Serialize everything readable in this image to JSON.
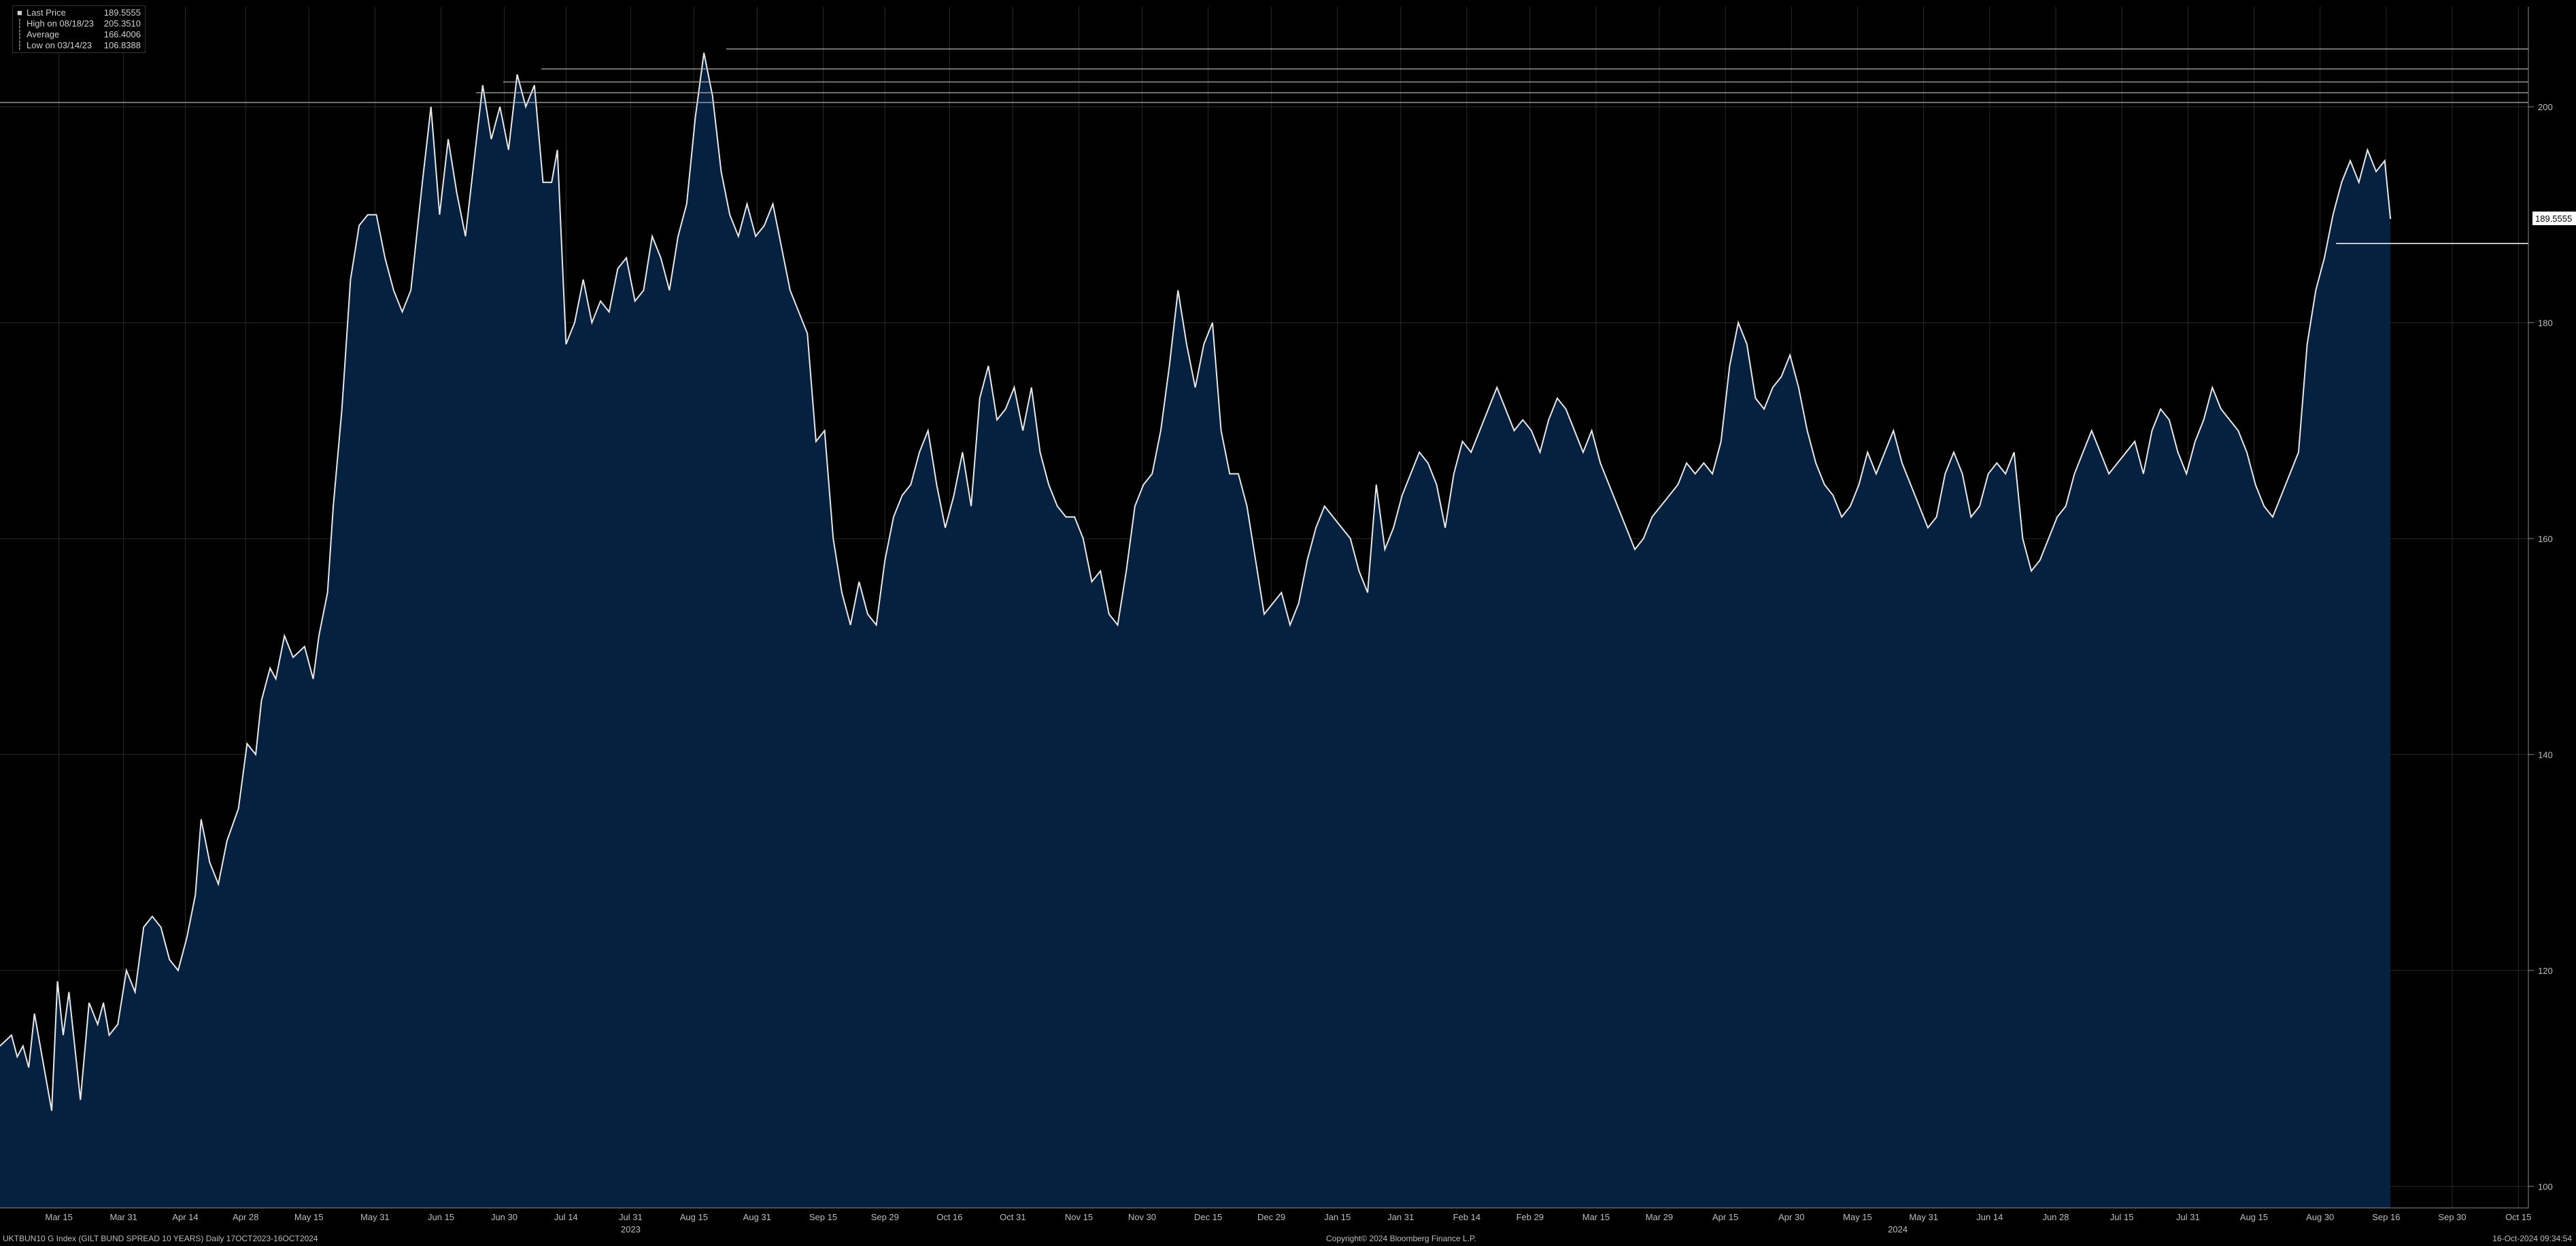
{
  "legend": [
    {
      "label": "Last Price",
      "value": "189.5555",
      "color": "#ffffff",
      "marker": "box"
    },
    {
      "label": "High on 08/18/23",
      "value": "205.3510",
      "color": "#ffffff",
      "marker": "line"
    },
    {
      "label": "Average",
      "value": "166.4006",
      "color": "#ffffff",
      "marker": "line"
    },
    {
      "label": "Low on 03/14/23",
      "value": "106.8388",
      "color": "#ffffff",
      "marker": "line"
    }
  ],
  "footer": {
    "left": "UKTBUN10 G Index (GILT BUND SPREAD 10 YEARS)  Daily 17OCT2023-16OCT2024",
    "center": "Copyright© 2024 Bloomberg Finance L.P.",
    "right": "16-Oct-2024 09:34:54"
  },
  "colors": {
    "background": "#000000",
    "fill": "#06203f",
    "line": "#e8e8e8",
    "grid": "#2a2a2a"
  },
  "chart_data": {
    "type": "area",
    "ylim": [
      98,
      208
    ],
    "yticks": [
      100,
      120,
      140,
      160,
      180,
      200
    ],
    "last_price_label": "189.5555",
    "x_tick_labels": [
      "Mar 15",
      "Mar 31",
      "Apr 14",
      "Apr 28",
      "May 15",
      "May 31",
      "Jun 15",
      "Jun 30",
      "Jul 14",
      "Jul 31",
      "Aug 15",
      "Aug 31",
      "Sep 15",
      "Sep 29",
      "Oct 16",
      "Oct 31",
      "Nov 15",
      "Nov 30",
      "Dec 15",
      "Dec 29",
      "Jan 15",
      "Jan 31",
      "Feb 14",
      "Feb 29",
      "Mar 15",
      "Mar 29",
      "Apr 15",
      "Apr 30",
      "May 15",
      "May 31",
      "Jun 14",
      "Jun 28",
      "Jul 15",
      "Jul 31",
      "Aug 15",
      "Aug 30",
      "Sep 16",
      "Sep 30",
      "Oct 15"
    ],
    "x_tick_index": [
      41,
      86,
      129,
      171,
      215,
      261,
      307,
      351,
      394,
      439,
      483,
      527,
      573,
      616,
      661,
      705,
      751,
      795,
      841,
      885,
      931,
      975,
      1021,
      1065,
      1111,
      1155,
      1201,
      1247,
      1293,
      1339,
      1385,
      1431,
      1477,
      1523,
      1569,
      1615,
      1661,
      1707,
      1753
    ],
    "year_labels": [
      {
        "label": "2023",
        "at": 439
      },
      {
        "label": "2024",
        "at": 1321
      }
    ],
    "x_range": [
      0,
      1760
    ],
    "series": [
      {
        "points": [
          [
            0,
            113
          ],
          [
            8,
            114
          ],
          [
            12,
            112
          ],
          [
            16,
            113
          ],
          [
            20,
            111
          ],
          [
            24,
            116
          ],
          [
            28,
            113
          ],
          [
            32,
            110
          ],
          [
            36,
            107
          ],
          [
            40,
            119
          ],
          [
            44,
            114
          ],
          [
            48,
            118
          ],
          [
            52,
            113
          ],
          [
            56,
            108
          ],
          [
            62,
            117
          ],
          [
            68,
            115
          ],
          [
            72,
            117
          ],
          [
            76,
            114
          ],
          [
            82,
            115
          ],
          [
            88,
            120
          ],
          [
            94,
            118
          ],
          [
            100,
            124
          ],
          [
            106,
            125
          ],
          [
            112,
            124
          ],
          [
            118,
            121
          ],
          [
            124,
            120
          ],
          [
            130,
            123
          ],
          [
            136,
            127
          ],
          [
            140,
            134
          ],
          [
            146,
            130
          ],
          [
            152,
            128
          ],
          [
            158,
            132
          ],
          [
            166,
            135
          ],
          [
            172,
            141
          ],
          [
            178,
            140
          ],
          [
            182,
            145
          ],
          [
            188,
            148
          ],
          [
            192,
            147
          ],
          [
            198,
            151
          ],
          [
            204,
            149
          ],
          [
            212,
            150
          ],
          [
            218,
            147
          ],
          [
            222,
            151
          ],
          [
            228,
            155
          ],
          [
            232,
            163
          ],
          [
            238,
            172
          ],
          [
            244,
            184
          ],
          [
            250,
            189
          ],
          [
            256,
            190
          ],
          [
            262,
            190
          ],
          [
            268,
            186
          ],
          [
            274,
            183
          ],
          [
            280,
            181
          ],
          [
            286,
            183
          ],
          [
            294,
            193
          ],
          [
            300,
            200
          ],
          [
            306,
            190
          ],
          [
            312,
            197
          ],
          [
            318,
            192
          ],
          [
            324,
            188
          ],
          [
            330,
            195
          ],
          [
            336,
            202
          ],
          [
            342,
            197
          ],
          [
            348,
            200
          ],
          [
            354,
            196
          ],
          [
            360,
            203
          ],
          [
            366,
            200
          ],
          [
            372,
            202
          ],
          [
            378,
            193
          ],
          [
            384,
            193
          ],
          [
            388,
            196
          ],
          [
            394,
            178
          ],
          [
            400,
            180
          ],
          [
            406,
            184
          ],
          [
            412,
            180
          ],
          [
            418,
            182
          ],
          [
            424,
            181
          ],
          [
            430,
            185
          ],
          [
            436,
            186
          ],
          [
            442,
            182
          ],
          [
            448,
            183
          ],
          [
            454,
            188
          ],
          [
            460,
            186
          ],
          [
            466,
            183
          ],
          [
            472,
            188
          ],
          [
            478,
            191
          ],
          [
            484,
            199
          ],
          [
            490,
            205
          ],
          [
            496,
            201
          ],
          [
            502,
            194
          ],
          [
            508,
            190
          ],
          [
            514,
            188
          ],
          [
            520,
            191
          ],
          [
            526,
            188
          ],
          [
            532,
            189
          ],
          [
            538,
            191
          ],
          [
            544,
            187
          ],
          [
            550,
            183
          ],
          [
            556,
            181
          ],
          [
            562,
            179
          ],
          [
            568,
            169
          ],
          [
            574,
            170
          ],
          [
            580,
            160
          ],
          [
            586,
            155
          ],
          [
            592,
            152
          ],
          [
            598,
            156
          ],
          [
            604,
            153
          ],
          [
            610,
            152
          ],
          [
            616,
            158
          ],
          [
            622,
            162
          ],
          [
            628,
            164
          ],
          [
            634,
            165
          ],
          [
            640,
            168
          ],
          [
            646,
            170
          ],
          [
            652,
            165
          ],
          [
            658,
            161
          ],
          [
            664,
            164
          ],
          [
            670,
            168
          ],
          [
            676,
            163
          ],
          [
            682,
            173
          ],
          [
            688,
            176
          ],
          [
            694,
            171
          ],
          [
            700,
            172
          ],
          [
            706,
            174
          ],
          [
            712,
            170
          ],
          [
            718,
            174
          ],
          [
            724,
            168
          ],
          [
            730,
            165
          ],
          [
            736,
            163
          ],
          [
            742,
            162
          ],
          [
            748,
            162
          ],
          [
            754,
            160
          ],
          [
            760,
            156
          ],
          [
            766,
            157
          ],
          [
            772,
            153
          ],
          [
            778,
            152
          ],
          [
            784,
            157
          ],
          [
            790,
            163
          ],
          [
            796,
            165
          ],
          [
            802,
            166
          ],
          [
            808,
            170
          ],
          [
            814,
            176
          ],
          [
            820,
            183
          ],
          [
            826,
            178
          ],
          [
            832,
            174
          ],
          [
            838,
            178
          ],
          [
            844,
            180
          ],
          [
            850,
            170
          ],
          [
            856,
            166
          ],
          [
            862,
            166
          ],
          [
            868,
            163
          ],
          [
            874,
            158
          ],
          [
            880,
            153
          ],
          [
            886,
            154
          ],
          [
            892,
            155
          ],
          [
            898,
            152
          ],
          [
            904,
            154
          ],
          [
            910,
            158
          ],
          [
            916,
            161
          ],
          [
            922,
            163
          ],
          [
            928,
            162
          ],
          [
            934,
            161
          ],
          [
            940,
            160
          ],
          [
            946,
            157
          ],
          [
            952,
            155
          ],
          [
            958,
            165
          ],
          [
            964,
            159
          ],
          [
            970,
            161
          ],
          [
            976,
            164
          ],
          [
            982,
            166
          ],
          [
            988,
            168
          ],
          [
            994,
            167
          ],
          [
            1000,
            165
          ],
          [
            1006,
            161
          ],
          [
            1012,
            166
          ],
          [
            1018,
            169
          ],
          [
            1024,
            168
          ],
          [
            1030,
            170
          ],
          [
            1036,
            172
          ],
          [
            1042,
            174
          ],
          [
            1048,
            172
          ],
          [
            1054,
            170
          ],
          [
            1060,
            171
          ],
          [
            1066,
            170
          ],
          [
            1072,
            168
          ],
          [
            1078,
            171
          ],
          [
            1084,
            173
          ],
          [
            1090,
            172
          ],
          [
            1096,
            170
          ],
          [
            1102,
            168
          ],
          [
            1108,
            170
          ],
          [
            1114,
            167
          ],
          [
            1120,
            165
          ],
          [
            1126,
            163
          ],
          [
            1132,
            161
          ],
          [
            1138,
            159
          ],
          [
            1144,
            160
          ],
          [
            1150,
            162
          ],
          [
            1156,
            163
          ],
          [
            1162,
            164
          ],
          [
            1168,
            165
          ],
          [
            1174,
            167
          ],
          [
            1180,
            166
          ],
          [
            1186,
            167
          ],
          [
            1192,
            166
          ],
          [
            1198,
            169
          ],
          [
            1204,
            176
          ],
          [
            1210,
            180
          ],
          [
            1216,
            178
          ],
          [
            1222,
            173
          ],
          [
            1228,
            172
          ],
          [
            1234,
            174
          ],
          [
            1240,
            175
          ],
          [
            1246,
            177
          ],
          [
            1252,
            174
          ],
          [
            1258,
            170
          ],
          [
            1264,
            167
          ],
          [
            1270,
            165
          ],
          [
            1276,
            164
          ],
          [
            1282,
            162
          ],
          [
            1288,
            163
          ],
          [
            1294,
            165
          ],
          [
            1300,
            168
          ],
          [
            1306,
            166
          ],
          [
            1312,
            168
          ],
          [
            1318,
            170
          ],
          [
            1324,
            167
          ],
          [
            1330,
            165
          ],
          [
            1336,
            163
          ],
          [
            1342,
            161
          ],
          [
            1348,
            162
          ],
          [
            1354,
            166
          ],
          [
            1360,
            168
          ],
          [
            1366,
            166
          ],
          [
            1372,
            162
          ],
          [
            1378,
            163
          ],
          [
            1384,
            166
          ],
          [
            1390,
            167
          ],
          [
            1396,
            166
          ],
          [
            1402,
            168
          ],
          [
            1408,
            160
          ],
          [
            1414,
            157
          ],
          [
            1420,
            158
          ],
          [
            1426,
            160
          ],
          [
            1432,
            162
          ],
          [
            1438,
            163
          ],
          [
            1444,
            166
          ],
          [
            1450,
            168
          ],
          [
            1456,
            170
          ],
          [
            1462,
            168
          ],
          [
            1468,
            166
          ],
          [
            1474,
            167
          ],
          [
            1480,
            168
          ],
          [
            1486,
            169
          ],
          [
            1492,
            166
          ],
          [
            1498,
            170
          ],
          [
            1504,
            172
          ],
          [
            1510,
            171
          ],
          [
            1516,
            168
          ],
          [
            1522,
            166
          ],
          [
            1528,
            169
          ],
          [
            1534,
            171
          ],
          [
            1540,
            174
          ],
          [
            1546,
            172
          ],
          [
            1552,
            171
          ],
          [
            1558,
            170
          ],
          [
            1564,
            168
          ],
          [
            1570,
            165
          ],
          [
            1576,
            163
          ],
          [
            1582,
            162
          ],
          [
            1588,
            164
          ],
          [
            1594,
            166
          ],
          [
            1600,
            168
          ],
          [
            1606,
            178
          ],
          [
            1612,
            183
          ],
          [
            1618,
            186
          ],
          [
            1624,
            190
          ],
          [
            1630,
            193
          ],
          [
            1636,
            195
          ],
          [
            1642,
            193
          ],
          [
            1648,
            196
          ],
          [
            1654,
            194
          ],
          [
            1660,
            195
          ],
          [
            1664,
            189.6
          ]
        ]
      }
    ],
    "reference_lines": [
      205.351,
      203.5,
      202.3,
      201.3,
      200.4
    ]
  }
}
